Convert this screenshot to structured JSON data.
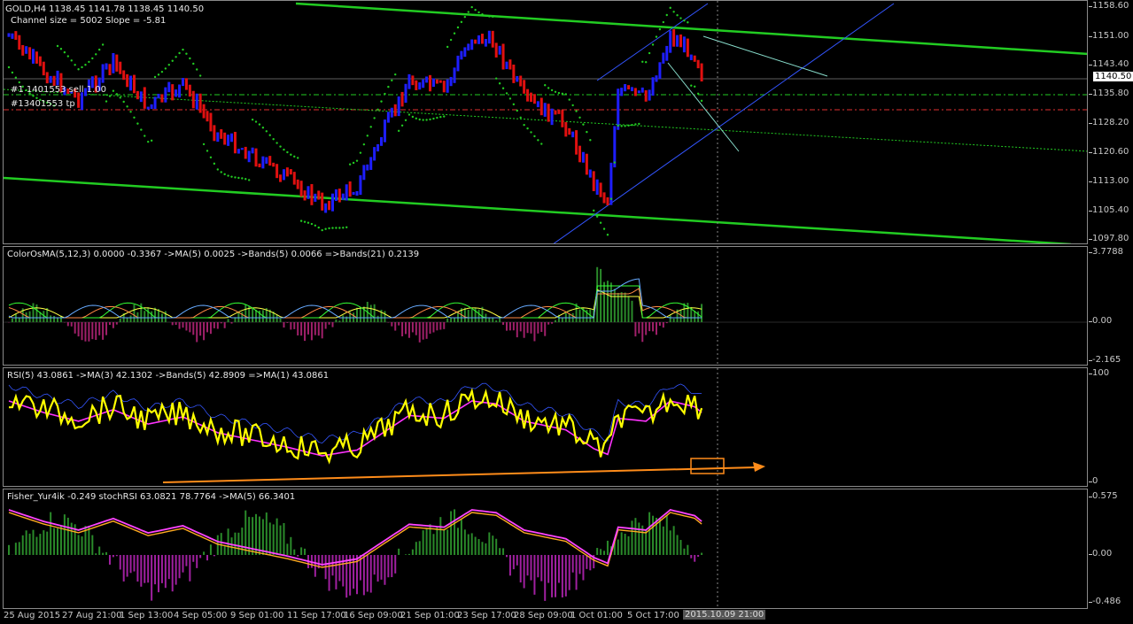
{
  "main_pane": {
    "header": "GOLD,H4  1138.45  1141.78  1138.45  1140.50",
    "channel_info": "Channel size = 5002 Slope = -5.81",
    "order_line_1": "#1 1401553 sell 1.00",
    "order_line_2": "#13401553 tp",
    "current_price": "1140.50",
    "y_ticks": [
      "1158.60",
      "1151.00",
      "1143.40",
      "1135.80",
      "1128.20",
      "1120.60",
      "1113.00",
      "1105.40",
      "1097.80"
    ]
  },
  "osma_pane": {
    "header": "ColorOsMA(5,12,3) 0.0000 -0.3367  ->MA(5) 0.0025  ->Bands(5) 0.0066  =>Bands(21) 0.2139",
    "y_ticks": [
      "3.7788",
      "0.00",
      "-2.165"
    ]
  },
  "rsi_pane": {
    "header": "RSI(5) 43.0861  ->MA(3) 42.1302  ->Bands(5) 42.8909  =>MA(1) 43.0861",
    "y_ticks": [
      "100",
      "0"
    ]
  },
  "fisher_pane": {
    "header": "Fisher_Yur4ik -0.249  stochRSI 63.0821 78.7764  ->MA(5) 66.3401",
    "y_ticks": [
      "0.575",
      "0.00",
      "-0.486"
    ]
  },
  "x_axis": {
    "labels": [
      "25 Aug 2015",
      "27 Aug 21:00",
      "1 Sep 13:00",
      "4 Sep 05:00",
      "9 Sep 01:00",
      "11 Sep 17:00",
      "16 Sep 09:00",
      "21 Sep 01:00",
      "23 Sep 17:00",
      "28 Sep 09:00",
      "1 Oct 01:00",
      "5 Oct 17:00"
    ],
    "cursor_label": "2015.10.09 21:00"
  },
  "colors": {
    "bull": "#1e1eff",
    "bear": "#e01010",
    "channel": "#22cc22",
    "psar": "#22cc22",
    "rsi": "#ffff00",
    "rsi_ma": "#ff33ff",
    "arrow": "#ff8c1a"
  }
}
